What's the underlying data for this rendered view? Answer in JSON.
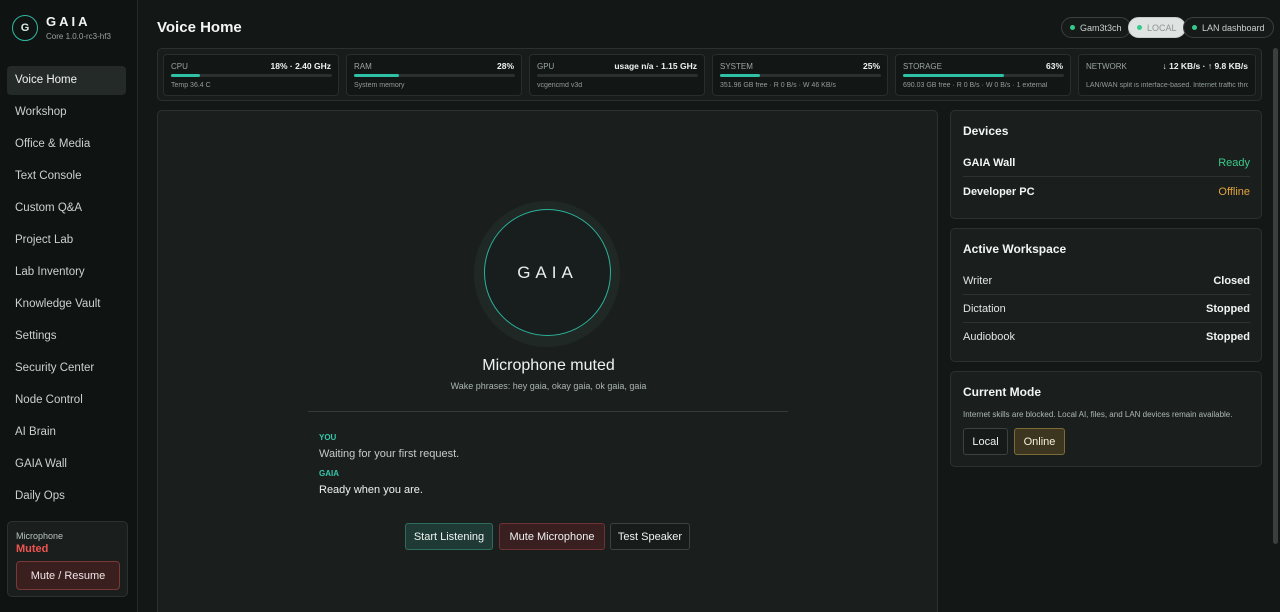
{
  "brand": {
    "logo_letter": "G",
    "name": "GAIA",
    "version": "Core 1.0.0-rc3-hf3"
  },
  "nav": {
    "active_index": 0,
    "items": [
      "Voice Home",
      "Workshop",
      "Office & Media",
      "Text Console",
      "Custom Q&A",
      "Project Lab",
      "Lab Inventory",
      "Knowledge Vault",
      "Settings",
      "Security Center",
      "Node Control",
      "AI Brain",
      "GAIA Wall",
      "Daily Ops"
    ]
  },
  "sidebar_mic": {
    "title": "Microphone",
    "state": "Muted",
    "button": "Mute / Resume"
  },
  "header": {
    "title": "Voice Home",
    "pills": {
      "user": "Gam3t3ch",
      "mode": "LOCAL",
      "lan": "LAN dashboard"
    }
  },
  "stats": [
    {
      "label": "CPU",
      "value": "18% · 2.40 GHz",
      "fill_pct": 18,
      "sub": "Temp 36.4 C",
      "bar": true
    },
    {
      "label": "RAM",
      "value": "28%",
      "fill_pct": 28,
      "sub": "System memory",
      "bar": true
    },
    {
      "label": "GPU",
      "value": "usage n/a · 1.15 GHz",
      "fill_pct": 0,
      "sub": "vcgencmd v3d",
      "bar": true
    },
    {
      "label": "SYSTEM",
      "value": "25%",
      "fill_pct": 25,
      "sub": "351.96 GB free · R 0 B/s · W 46 KB/s",
      "bar": true
    },
    {
      "label": "STORAGE",
      "value": "63%",
      "fill_pct": 63,
      "sub": "690.03 GB free · R 0 B/s · W 0 B/s · 1 external",
      "bar": true
    },
    {
      "label": "NETWORK",
      "value": "↓ 12 KB/s · ↑ 9.8 KB/s",
      "fill_pct": 0,
      "sub": "LAN/WAN split is interface-based. Internet traffic thro...",
      "bar": false
    }
  ],
  "voice": {
    "orb_text": "GAIA",
    "status": "Microphone muted",
    "wake_phrases": "Wake phrases: hey gaia, okay gaia, ok gaia, gaia",
    "conversation": {
      "you_label": "YOU",
      "you_text": "Waiting for your first request.",
      "gaia_label": "GAIA",
      "gaia_text": "Ready when you are."
    },
    "buttons": {
      "start": "Start Listening",
      "mute": "Mute Microphone",
      "test": "Test Speaker"
    }
  },
  "devices": {
    "title": "Devices",
    "items": [
      {
        "name": "GAIA Wall",
        "status": "Ready",
        "color": "#3cc88a"
      },
      {
        "name": "Developer PC",
        "status": "Offline",
        "color": "#e0a33c"
      }
    ]
  },
  "workspace": {
    "title": "Active Workspace",
    "items": [
      {
        "name": "Writer",
        "status": "Closed"
      },
      {
        "name": "Dictation",
        "status": "Stopped"
      },
      {
        "name": "Audiobook",
        "status": "Stopped"
      }
    ]
  },
  "mode": {
    "title": "Current Mode",
    "description": "Internet skills are blocked. Local AI, files, and LAN devices remain available.",
    "local": "Local",
    "online": "Online"
  }
}
